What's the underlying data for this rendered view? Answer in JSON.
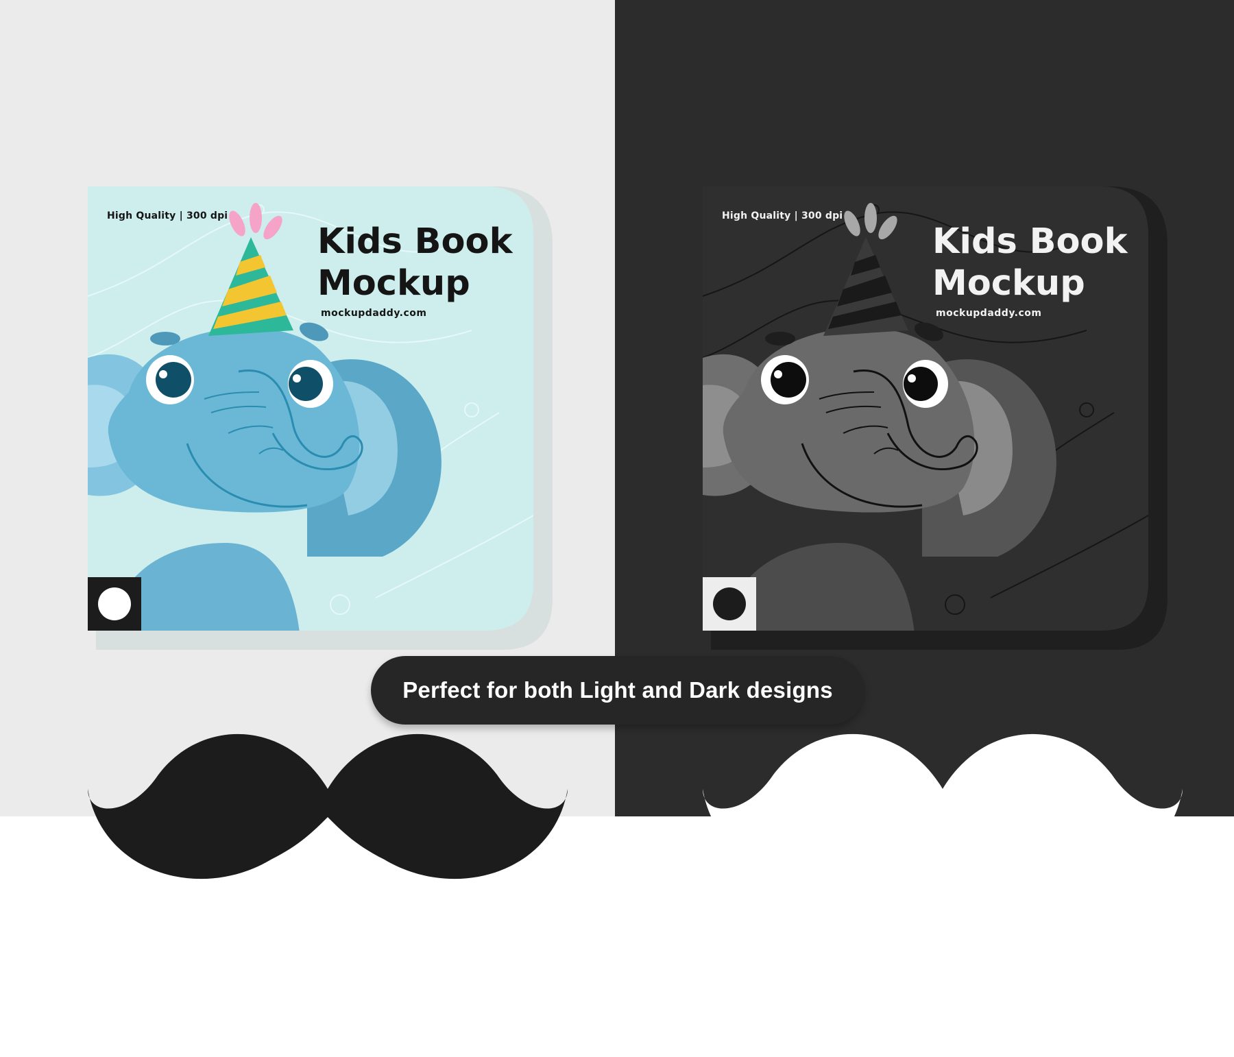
{
  "colors": {
    "light_background": "#ebebeb",
    "dark_background": "#2c2c2c",
    "light_cover": "#cdeeed",
    "dark_cover": "#2f2f2f",
    "elephant_blue": "#6bb8d6",
    "banner_background": "#262626"
  },
  "light_book": {
    "meta": "High Quality | 300 dpi",
    "title_line1": "Kids Book",
    "title_line2": "Mockup",
    "website": "mockupdaddy.com",
    "logo_icon": "mustache-icon"
  },
  "dark_book": {
    "meta": "High Quality | 300 dpi",
    "title_line1": "Kids Book",
    "title_line2": "Mockup",
    "website": "mockupdaddy.com",
    "logo_icon": "mustache-icon"
  },
  "banner": {
    "text": "Perfect for both Light and Dark designs"
  }
}
